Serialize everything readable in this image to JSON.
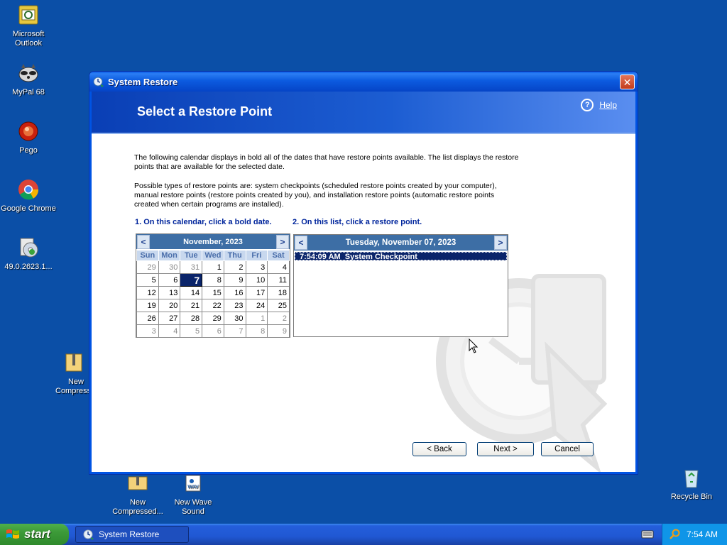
{
  "desktop": {
    "icons": [
      {
        "label": "Microsoft Outlook"
      },
      {
        "label": "MyPal 68"
      },
      {
        "label": "Pego"
      },
      {
        "label": "Google Chrome"
      },
      {
        "label": "49.0.2623.1..."
      },
      {
        "label": "New Compress..."
      },
      {
        "label": "New Compressed..."
      },
      {
        "label": "New Wave Sound"
      },
      {
        "label": "Recycle Bin"
      }
    ]
  },
  "window": {
    "title": "System Restore",
    "close_label": "✕",
    "header_title": "Select a Restore Point",
    "help_label": "Help",
    "intro_1": "The following calendar displays in bold all of the dates that have restore points available. The list displays the restore points that are available for the selected date.",
    "intro_2": "Possible types of restore points are: system checkpoints (scheduled restore points created by your computer), manual restore points (restore points created by you), and installation restore points (automatic restore points created when certain programs are installed).",
    "step1_label": "1. On this calendar, click a bold date.",
    "step2_label": "2. On this list, click a restore point."
  },
  "calendar": {
    "month_label": "November, 2023",
    "prev": "<",
    "next": ">",
    "weekdays": [
      "Sun",
      "Mon",
      "Tue",
      "Wed",
      "Thu",
      "Fri",
      "Sat"
    ],
    "weeks": [
      [
        "29",
        "30",
        "31",
        "1",
        "2",
        "3",
        "4"
      ],
      [
        "5",
        "6",
        "7",
        "8",
        "9",
        "10",
        "11"
      ],
      [
        "12",
        "13",
        "14",
        "15",
        "16",
        "17",
        "18"
      ],
      [
        "19",
        "20",
        "21",
        "22",
        "23",
        "24",
        "25"
      ],
      [
        "26",
        "27",
        "28",
        "29",
        "30",
        "1",
        "2"
      ],
      [
        "3",
        "4",
        "5",
        "6",
        "7",
        "8",
        "9"
      ]
    ],
    "selected": "7"
  },
  "restore_list": {
    "date_label": "Tuesday, November 07, 2023",
    "prev": "<",
    "next": ">",
    "items": [
      {
        "time": "7:54:09 AM",
        "description": "System Checkpoint"
      }
    ]
  },
  "buttons": {
    "back": "< Back",
    "next": "Next >",
    "cancel": "Cancel"
  },
  "taskbar": {
    "start_label": "start",
    "task_label": "System Restore",
    "clock": "7:54 AM"
  }
}
